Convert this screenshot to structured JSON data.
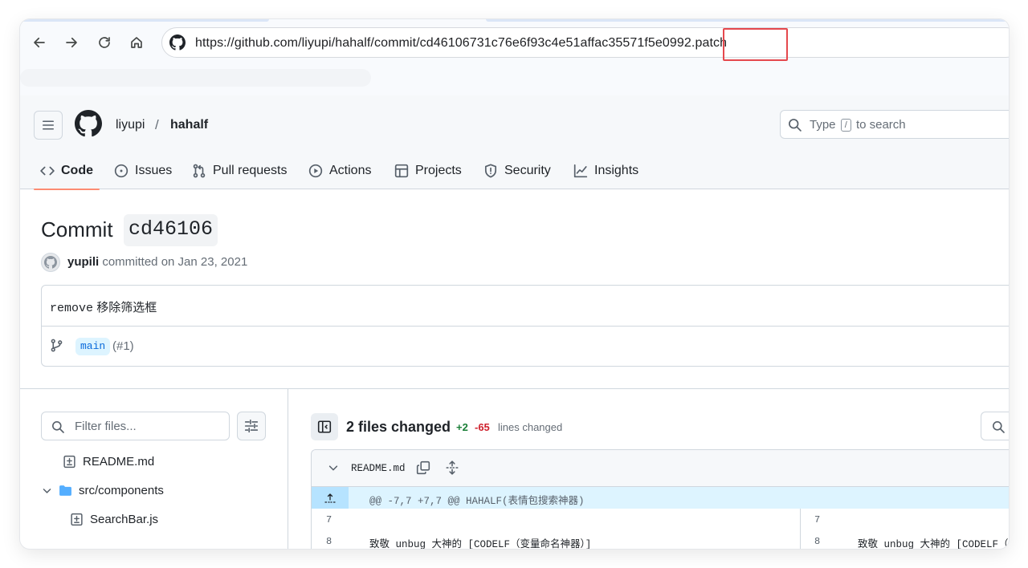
{
  "browser": {
    "url_prefix": "https://github.com/liyupi/hahalf/commit/cd46106731c76e6f93c4e51affac35571f5e0992",
    "url_suffix": ".patch"
  },
  "header": {
    "owner": "liyupi",
    "separator": "/",
    "repo": "hahalf",
    "search": {
      "prefix": "Type",
      "key": "/",
      "suffix": "to search"
    }
  },
  "tabs": [
    {
      "label": "Code",
      "icon": "code-icon"
    },
    {
      "label": "Issues",
      "icon": "issue-icon"
    },
    {
      "label": "Pull requests",
      "icon": "pull-request-icon"
    },
    {
      "label": "Actions",
      "icon": "play-icon"
    },
    {
      "label": "Projects",
      "icon": "table-icon"
    },
    {
      "label": "Security",
      "icon": "shield-icon"
    },
    {
      "label": "Insights",
      "icon": "graph-icon"
    }
  ],
  "commit": {
    "title": "Commit",
    "sha": "cd46106",
    "author": "yupili",
    "committed_text": "committed on Jan 23, 2021",
    "message_code": "remove",
    "message_text": "移除筛选框",
    "branch": "main",
    "pr_ref": "(#1)"
  },
  "file_tree": {
    "filter_placeholder": "Filter files...",
    "items": [
      {
        "label": "README.md",
        "type": "file-diff"
      },
      {
        "label": "src/components",
        "type": "folder"
      },
      {
        "label": "SearchBar.js",
        "type": "file-diff"
      }
    ]
  },
  "diff": {
    "summary": "2 files changed",
    "additions": "+2",
    "deletions": "-65",
    "lines_changed": "lines changed",
    "file": {
      "name": "README.md",
      "hunk": "@@ -7,7 +7,7 @@ HAHALF(表情包搜索神器)",
      "rows": [
        {
          "left_ln": "7",
          "left_code": "",
          "right_ln": "7",
          "right_code": ""
        },
        {
          "left_ln": "8",
          "left_code": "致敬 unbug 大神的 [CODELF（变量命名神器）]",
          "right_ln": "8",
          "right_code": "致敬 unbug 大神的 [CODELF（"
        }
      ]
    }
  },
  "colors": {
    "accent_underline": "#fd8c73",
    "highlight_box": "#e5484d",
    "additions": "#1a7f37",
    "deletions": "#cf222e",
    "hunk_bg": "#ddf4ff"
  }
}
